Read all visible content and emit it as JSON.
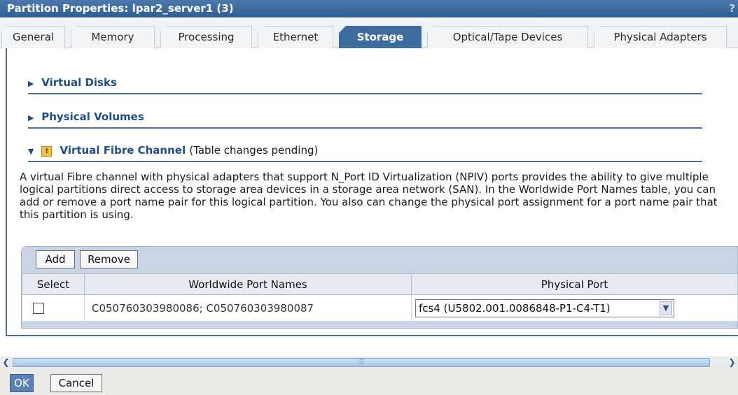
{
  "window": {
    "title": "Partition Properties: lpar2_server1 (3)",
    "help_glyph": "?"
  },
  "tabs": [
    {
      "label": "General"
    },
    {
      "label": "Memory"
    },
    {
      "label": "Processing"
    },
    {
      "label": "Ethernet"
    },
    {
      "label": "Storage",
      "active": true
    },
    {
      "label": "Optical/Tape Devices"
    },
    {
      "label": "Physical Adapters"
    }
  ],
  "sections": {
    "virtual_disks": "Virtual Disks",
    "physical_volumes": "Physical Volumes",
    "virtual_fibre_channel": "Virtual Fibre Channel",
    "vfc_status": "(Table changes pending)"
  },
  "description": "A virtual Fibre channel with physical adapters that support N_Port ID Virtualization (NPIV) ports provides the ability to give multiple logical partitions direct access to storage area devices in a storage area network (SAN). In the Worldwide Port Names table, you can add or remove a port name pair for this logical partition. You also can change the physical port assignment for a port name pair that this partition is using.",
  "table": {
    "add_label": "Add",
    "remove_label": "Remove",
    "columns": [
      "Select",
      "Worldwide Port Names",
      "Physical Port"
    ],
    "rows": [
      {
        "wwpn": "C050760303980086; C050760303980087",
        "physical_port": "fcs4 (U5802.001.0086848-P1-C4-T1)",
        "selected": false
      }
    ]
  },
  "footer": {
    "ok_label": "OK",
    "cancel_label": "Cancel"
  },
  "icons": {
    "expand": "collapsed-triangle-icon",
    "collapse": "expanded-triangle-icon",
    "warning": "warning-icon",
    "dropdown": "chevron-down-icon"
  },
  "colors": {
    "accent": "#3d6c9f",
    "heading": "#1e4f86",
    "title_bar": "#3a6aa0"
  }
}
